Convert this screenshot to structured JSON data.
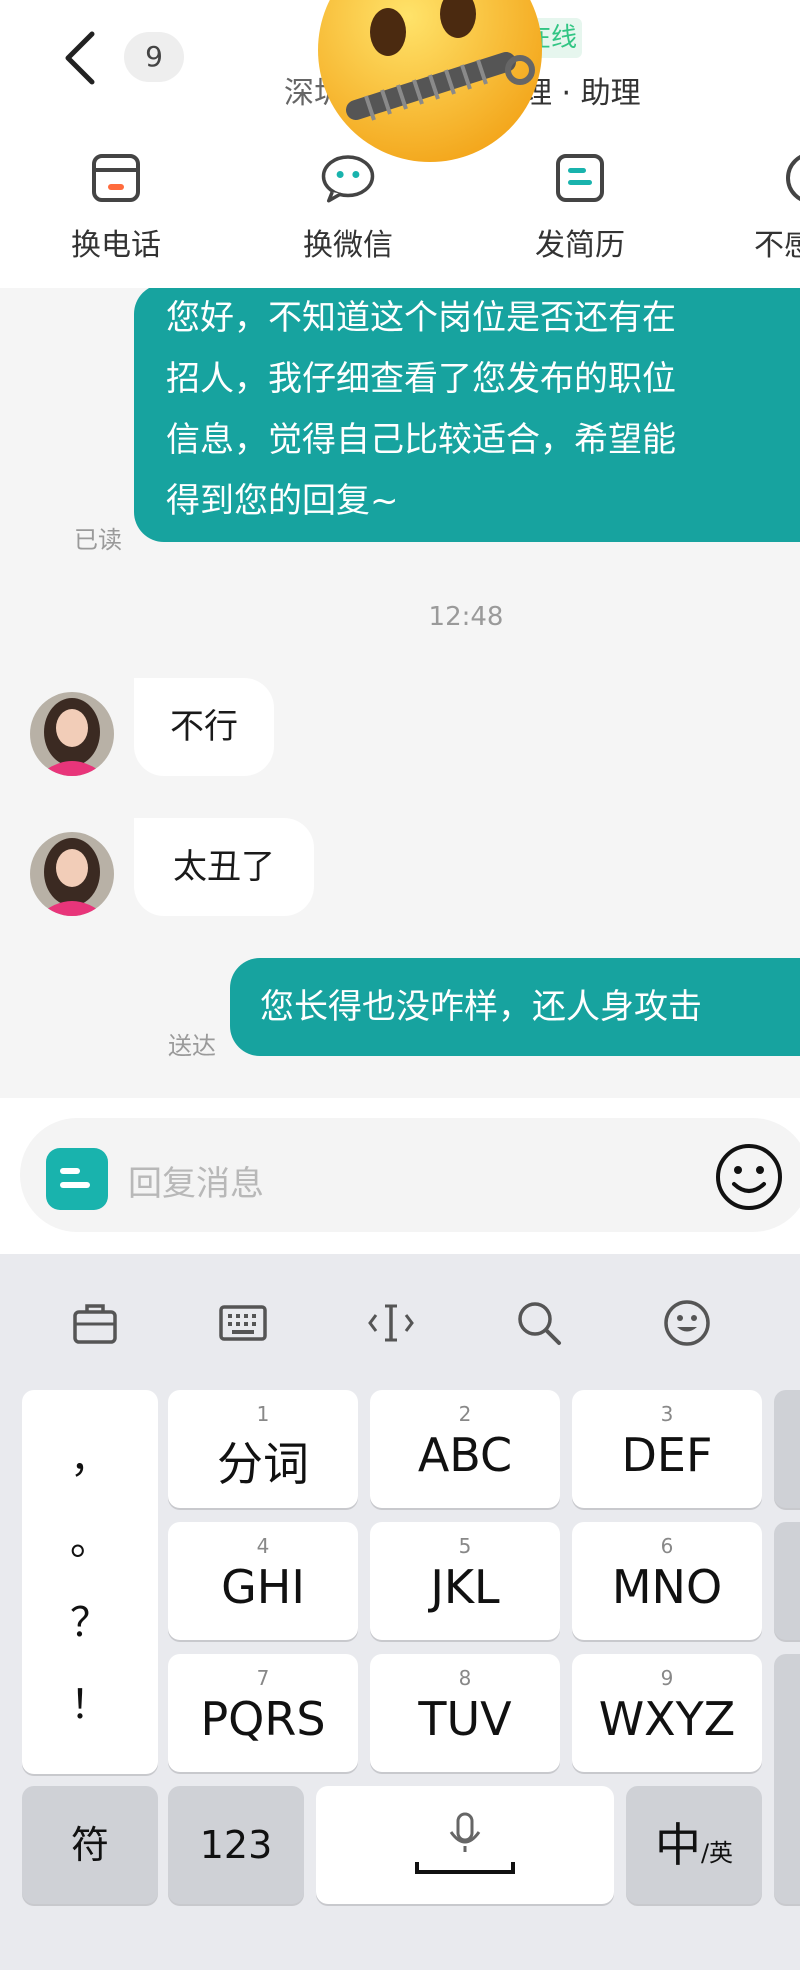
{
  "header": {
    "unread_count": "9",
    "online_status": "在线",
    "subtitle_left": "深圳",
    "subtitle_right": "理 · 助理"
  },
  "actions": [
    {
      "label": "换电话",
      "icon": "phone-swap-icon"
    },
    {
      "label": "换微信",
      "icon": "wechat-swap-icon"
    },
    {
      "label": "发简历",
      "icon": "resume-send-icon"
    },
    {
      "label": "不感",
      "icon": "not-interested-icon"
    }
  ],
  "chat": {
    "messages": [
      {
        "direction": "out",
        "lines": [
          "您好，不知道这个岗位是否还有在",
          "招人，我仔细查看了您发布的职位",
          "信息，觉得自己比较适合，希望能",
          "得到您的回复~"
        ],
        "status": "已读"
      },
      {
        "type": "timestamp",
        "text": "12:48"
      },
      {
        "direction": "in",
        "text": "不行"
      },
      {
        "direction": "in",
        "text": "太丑了"
      },
      {
        "direction": "out",
        "text": "您长得也没咋样，还人身攻击",
        "status": "送达"
      }
    ]
  },
  "input": {
    "placeholder": "回复消息"
  },
  "keyboard": {
    "toolbar": [
      "toolbox-icon",
      "keyboard-icon",
      "cursor-icon",
      "search-icon",
      "emoji-icon"
    ],
    "punctuation": [
      "，",
      "。",
      "？",
      "！"
    ],
    "keys": [
      {
        "num": "1",
        "label": "分词"
      },
      {
        "num": "2",
        "label": "ABC"
      },
      {
        "num": "3",
        "label": "DEF"
      },
      {
        "num": "4",
        "label": "GHI"
      },
      {
        "num": "5",
        "label": "JKL"
      },
      {
        "num": "6",
        "label": "MNO"
      },
      {
        "num": "7",
        "label": "PQRS"
      },
      {
        "num": "8",
        "label": "TUV"
      },
      {
        "num": "9",
        "label": "WXYZ"
      }
    ],
    "bottom": {
      "symbol": "符",
      "numbers": "123",
      "lang_main": "中",
      "lang_sub": "/英"
    }
  },
  "colors": {
    "accent": "#17a39f",
    "online": "#32c584",
    "bg": "#f5f5f5"
  }
}
